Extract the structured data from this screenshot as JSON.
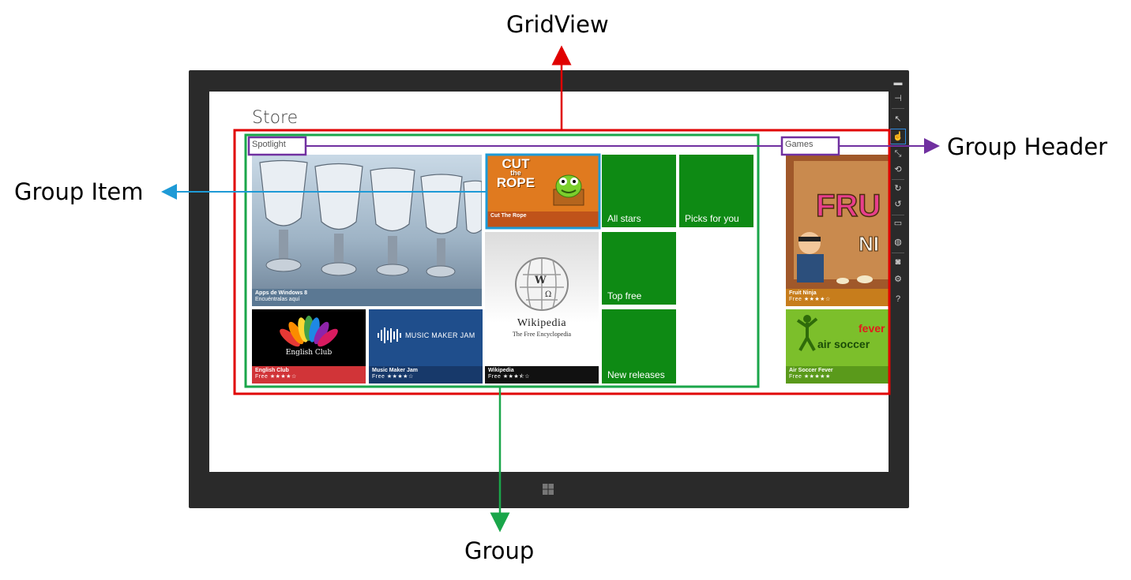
{
  "callouts": {
    "gridview": "GridView",
    "group_header": "Group Header",
    "group_item": "Group Item",
    "group": "Group"
  },
  "app": {
    "title": "Store"
  },
  "groups": [
    {
      "header": "Spotlight",
      "items": {
        "hero": {
          "title": "Apps de Windows 8",
          "subtitle": "Encuéntralas aquí"
        },
        "cut_the_rope": {
          "title": "Cut The Rope",
          "logo_line1": "CUT",
          "logo_line2": "the",
          "logo_line3": "ROPE"
        },
        "wikipedia": {
          "title": "Wikipedia",
          "rating_text": "Free ★★★⯪☆",
          "logo": "Wikipedia",
          "tagline": "The Free Encyclopedia"
        },
        "english_club": {
          "title": "English Club",
          "rating_text": "Free ★★★★☆",
          "logo": "English Club"
        },
        "music_maker": {
          "title": "Music Maker Jam",
          "rating_text": "Free ★★★★☆",
          "logo": "MUSIC MAKER JAM"
        },
        "all_stars": "All stars",
        "picks_for_you": "Picks for you",
        "top_free": "Top free",
        "new_releases": "New releases"
      }
    },
    {
      "header": "Games",
      "items": {
        "fruit_ninja": {
          "title": "Fruit Ninja",
          "rating_text": "Free ★★★★☆",
          "logo": "FRUIT NINJA"
        },
        "air_soccer": {
          "title": "Air Soccer Fever",
          "rating_text": "Free ★★★★★",
          "logo_1": "fever",
          "logo_2": "air soccer"
        }
      }
    }
  ],
  "sidebar": {
    "help_label": "?"
  },
  "colors": {
    "gridview_box": "#e00000",
    "group_box": "#1aa64a",
    "header_box": "#7030a0",
    "item_box": "#1e9ad6",
    "tile_green": "#0e8a14"
  }
}
